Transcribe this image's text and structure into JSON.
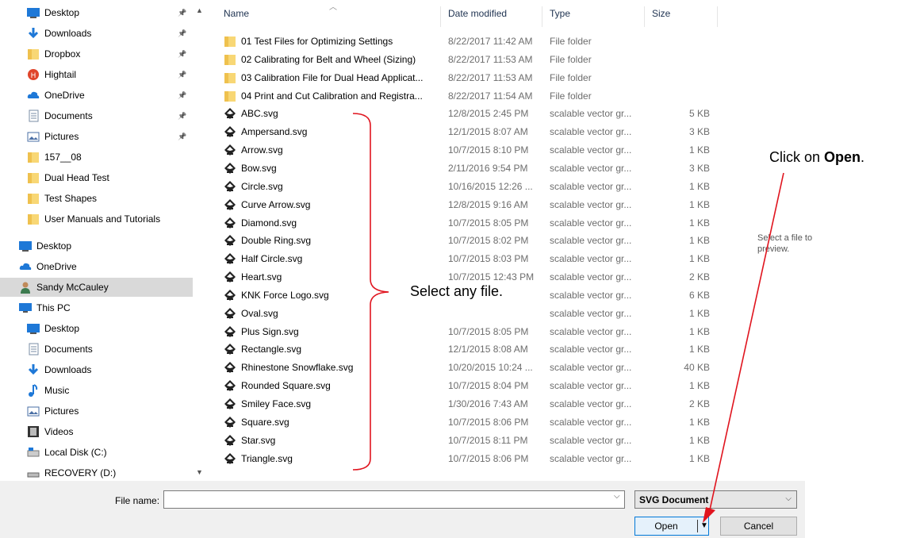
{
  "nav": {
    "items": [
      {
        "label": "Desktop",
        "icon": "desktop-icon",
        "pinned": true
      },
      {
        "label": "Downloads",
        "icon": "download-arrow-icon",
        "pinned": true
      },
      {
        "label": "Dropbox",
        "icon": "folder-icon",
        "pinned": true
      },
      {
        "label": "Hightail",
        "icon": "hightail-icon",
        "pinned": true
      },
      {
        "label": "OneDrive",
        "icon": "cloud-icon",
        "pinned": true
      },
      {
        "label": "Documents",
        "icon": "documents-icon",
        "pinned": true
      },
      {
        "label": "Pictures",
        "icon": "pictures-icon",
        "pinned": true
      },
      {
        "label": "157__08",
        "icon": "folder-icon",
        "pinned": false
      },
      {
        "label": "Dual Head Test",
        "icon": "folder-icon",
        "pinned": false
      },
      {
        "label": "Test Shapes",
        "icon": "folder-icon",
        "pinned": false
      },
      {
        "label": "User Manuals and Tutorials",
        "icon": "folder-icon",
        "pinned": false
      },
      {
        "label": "Desktop",
        "icon": "desktop-icon",
        "pinned": false
      },
      {
        "label": "OneDrive",
        "icon": "cloud-icon",
        "pinned": false
      },
      {
        "label": "Sandy McCauley",
        "icon": "user-icon",
        "pinned": false
      },
      {
        "label": "This PC",
        "icon": "computer-icon",
        "pinned": false
      },
      {
        "label": "Desktop",
        "icon": "desktop-icon",
        "pinned": false
      },
      {
        "label": "Documents",
        "icon": "documents-icon",
        "pinned": false
      },
      {
        "label": "Downloads",
        "icon": "download-arrow-icon",
        "pinned": false
      },
      {
        "label": "Music",
        "icon": "music-note-icon",
        "pinned": false
      },
      {
        "label": "Pictures",
        "icon": "pictures-icon",
        "pinned": false
      },
      {
        "label": "Videos",
        "icon": "film-icon",
        "pinned": false
      },
      {
        "label": "Local Disk (C:)",
        "icon": "disk-icon",
        "pinned": false
      },
      {
        "label": "RECOVERY (D:)",
        "icon": "drive-icon",
        "pinned": false
      }
    ],
    "selected_index": 13
  },
  "columns": {
    "name": "Name",
    "date": "Date modified",
    "type": "Type",
    "size": "Size"
  },
  "files": [
    {
      "name": "01 Test Files for Optimizing Settings",
      "date": "8/22/2017 11:42 AM",
      "type": "File folder",
      "size": "",
      "kind": "folder"
    },
    {
      "name": "02 Calibrating for Belt and Wheel (Sizing)",
      "date": "8/22/2017 11:53 AM",
      "type": "File folder",
      "size": "",
      "kind": "folder"
    },
    {
      "name": "03 Calibration File for Dual Head Applicat...",
      "date": "8/22/2017 11:53 AM",
      "type": "File folder",
      "size": "",
      "kind": "folder"
    },
    {
      "name": "04 Print and Cut Calibration and Registra...",
      "date": "8/22/2017 11:54 AM",
      "type": "File folder",
      "size": "",
      "kind": "folder"
    },
    {
      "name": "ABC.svg",
      "date": "12/8/2015 2:45 PM",
      "type": "scalable vector gr...",
      "size": "5 KB",
      "kind": "svg"
    },
    {
      "name": "Ampersand.svg",
      "date": "12/1/2015 8:07 AM",
      "type": "scalable vector gr...",
      "size": "3 KB",
      "kind": "svg"
    },
    {
      "name": "Arrow.svg",
      "date": "10/7/2015 8:10 PM",
      "type": "scalable vector gr...",
      "size": "1 KB",
      "kind": "svg"
    },
    {
      "name": "Bow.svg",
      "date": "2/11/2016 9:54 PM",
      "type": "scalable vector gr...",
      "size": "3 KB",
      "kind": "svg"
    },
    {
      "name": "Circle.svg",
      "date": "10/16/2015 12:26 ...",
      "type": "scalable vector gr...",
      "size": "1 KB",
      "kind": "svg"
    },
    {
      "name": "Curve Arrow.svg",
      "date": "12/8/2015 9:16 AM",
      "type": "scalable vector gr...",
      "size": "1 KB",
      "kind": "svg"
    },
    {
      "name": "Diamond.svg",
      "date": "10/7/2015 8:05 PM",
      "type": "scalable vector gr...",
      "size": "1 KB",
      "kind": "svg"
    },
    {
      "name": "Double Ring.svg",
      "date": "10/7/2015 8:02 PM",
      "type": "scalable vector gr...",
      "size": "1 KB",
      "kind": "svg"
    },
    {
      "name": "Half Circle.svg",
      "date": "10/7/2015 8:03 PM",
      "type": "scalable vector gr...",
      "size": "1 KB",
      "kind": "svg"
    },
    {
      "name": "Heart.svg",
      "date": "10/7/2015 12:43 PM",
      "type": "scalable vector gr...",
      "size": "2 KB",
      "kind": "svg"
    },
    {
      "name": "KNK Force Logo.svg",
      "date": "",
      "type": "scalable vector gr...",
      "size": "6 KB",
      "kind": "svg"
    },
    {
      "name": "Oval.svg",
      "date": "",
      "type": "scalable vector gr...",
      "size": "1 KB",
      "kind": "svg"
    },
    {
      "name": "Plus Sign.svg",
      "date": "10/7/2015 8:05 PM",
      "type": "scalable vector gr...",
      "size": "1 KB",
      "kind": "svg"
    },
    {
      "name": "Rectangle.svg",
      "date": "12/1/2015 8:08 AM",
      "type": "scalable vector gr...",
      "size": "1 KB",
      "kind": "svg"
    },
    {
      "name": "Rhinestone Snowflake.svg",
      "date": "10/20/2015 10:24 ...",
      "type": "scalable vector gr...",
      "size": "40 KB",
      "kind": "svg"
    },
    {
      "name": "Rounded Square.svg",
      "date": "10/7/2015 8:04 PM",
      "type": "scalable vector gr...",
      "size": "1 KB",
      "kind": "svg"
    },
    {
      "name": "Smiley Face.svg",
      "date": "1/30/2016 7:43 AM",
      "type": "scalable vector gr...",
      "size": "2 KB",
      "kind": "svg"
    },
    {
      "name": "Square.svg",
      "date": "10/7/2015 8:06 PM",
      "type": "scalable vector gr...",
      "size": "1 KB",
      "kind": "svg"
    },
    {
      "name": "Star.svg",
      "date": "10/7/2015 8:11 PM",
      "type": "scalable vector gr...",
      "size": "1 KB",
      "kind": "svg"
    },
    {
      "name": "Triangle.svg",
      "date": "10/7/2015 8:06 PM",
      "type": "scalable vector gr...",
      "size": "1 KB",
      "kind": "svg"
    }
  ],
  "preview": {
    "text": "Select a file to preview."
  },
  "bottom": {
    "file_name_label": "File name:",
    "file_name_value": "",
    "file_type": "SVG Document",
    "open_label": "Open",
    "cancel_label": "Cancel"
  },
  "annotations": {
    "select_prefix": "Select any file.",
    "click_prefix": "Click on ",
    "click_bold": "Open",
    "click_suffix": "."
  },
  "colors": {
    "annotation_red": "#e0141e",
    "selected_row": "#d9d9d9",
    "header_text": "#1e3250"
  }
}
